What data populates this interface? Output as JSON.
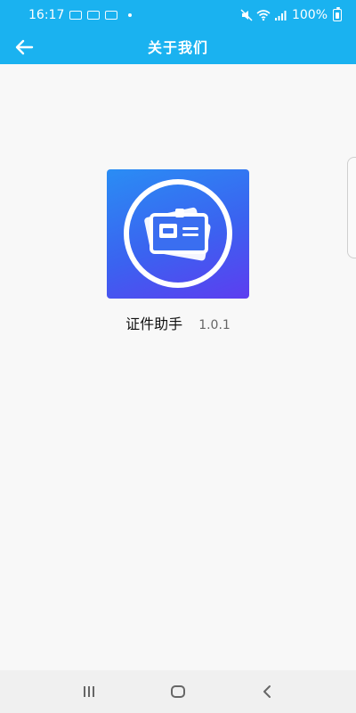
{
  "status_bar": {
    "time": "16:17",
    "battery_text": "100%",
    "badges": [
      "",
      "",
      ""
    ]
  },
  "header": {
    "title": "关于我们"
  },
  "app": {
    "name": "证件助手",
    "version": "1.0.1"
  },
  "colors": {
    "header_bg": "#1ab2f0",
    "icon_gradient_start": "#2a8df4",
    "icon_gradient_end": "#5d3df0",
    "background": "#f8f8f8"
  },
  "icons": {
    "back": "arrow-left-icon",
    "app_logo": "id-card-icon",
    "nav_recents": "recent-apps-icon",
    "nav_home": "home-icon",
    "nav_back": "chevron-left-icon"
  }
}
